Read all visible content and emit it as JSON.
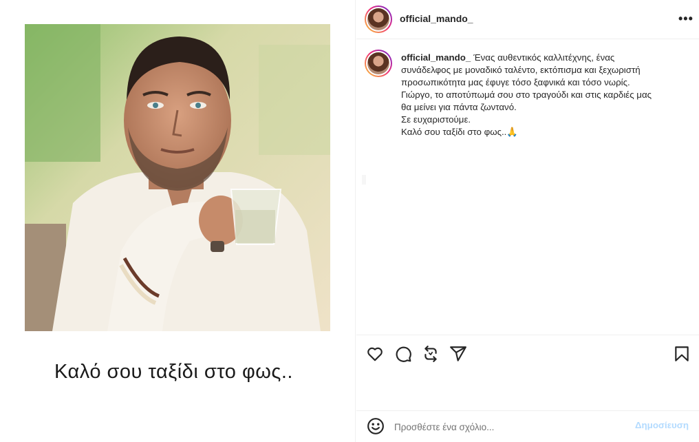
{
  "post": {
    "username": "official_mando_",
    "image_caption": "Καλό σου ταξίδι στο φως..",
    "caption_lines": [
      "Ένας αυθεντικός καλλιτέχνης, ένας",
      "συνάδελφος με μοναδικό ταλέντο, εκτόπισμα και ξεχωριστή",
      "προσωπικότητα μας έφυγε τόσο ξαφνικά και τόσο νωρίς.",
      "Γιώργο, το αποτύπωμά σου στο τραγούδι και στις καρδιές μας",
      "θα μείνει για πάντα ζωντανό.",
      "Σε ευχαριστούμε.",
      "Καλό σου ταξίδι στο φως..🙏"
    ],
    "more_label": "•••"
  },
  "comment_box": {
    "placeholder": "Προσθέστε ένα σχόλιο...",
    "post_label": "Δημοσίευση"
  },
  "icons": {
    "like": "heart-icon",
    "comment": "speech-bubble-icon",
    "repost": "repost-icon",
    "share": "paper-plane-icon",
    "save": "bookmark-icon",
    "emoji": "smiley-icon",
    "more": "ellipsis-icon"
  },
  "colors": {
    "text": "#262626",
    "placeholder": "#737373",
    "post_button_disabled": "#b3dbff",
    "divider": "#efefef"
  }
}
